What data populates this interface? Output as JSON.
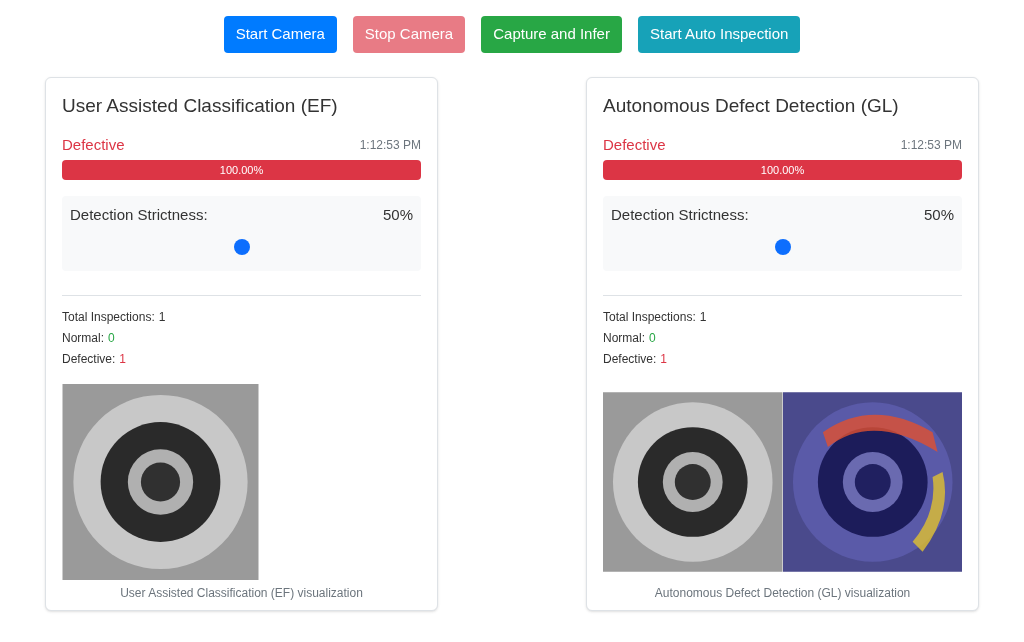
{
  "buttons": [
    {
      "label": "Start Camera",
      "kind": "primary",
      "disabled": false
    },
    {
      "label": "Stop Camera",
      "kind": "danger",
      "disabled": true
    },
    {
      "label": "Capture and Infer",
      "kind": "success",
      "disabled": false
    },
    {
      "label": "Start Auto Inspection",
      "kind": "info",
      "disabled": false
    }
  ],
  "panels": [
    {
      "title": "User Assisted Classification (EF)",
      "result": {
        "label": "Defective",
        "kind": "defective"
      },
      "time": "1:12:53 PM",
      "confidence": {
        "label": "100.00%",
        "level": 1
      },
      "strictness": {
        "label": "Detection Strictness:",
        "reading": "50%",
        "level": 0.5
      },
      "stats": [
        {
          "label": "Total Inspections:",
          "value": "1",
          "kind": "neutral"
        },
        {
          "label": "Normal:",
          "value": "0",
          "kind": "normal"
        },
        {
          "label": "Defective:",
          "value": "1",
          "kind": "defective"
        }
      ],
      "images": [
        {
          "kind": "photo"
        }
      ],
      "caption": "User Assisted Classification (EF) visualization"
    },
    {
      "title": "Autonomous Defect Detection (GL)",
      "result": {
        "label": "Defective",
        "kind": "defective"
      },
      "time": "1:12:53 PM",
      "confidence": {
        "label": "100.00%",
        "level": 1
      },
      "strictness": {
        "label": "Detection Strictness:",
        "reading": "50%",
        "level": 0.5
      },
      "stats": [
        {
          "label": "Total Inspections:",
          "value": "1",
          "kind": "neutral"
        },
        {
          "label": "Normal:",
          "value": "0",
          "kind": "normal"
        },
        {
          "label": "Defective:",
          "value": "1",
          "kind": "defective"
        }
      ],
      "images": [
        {
          "kind": "photo"
        },
        {
          "kind": "heatmap"
        }
      ],
      "caption": "Autonomous Defect Detection (GL) visualization"
    }
  ]
}
